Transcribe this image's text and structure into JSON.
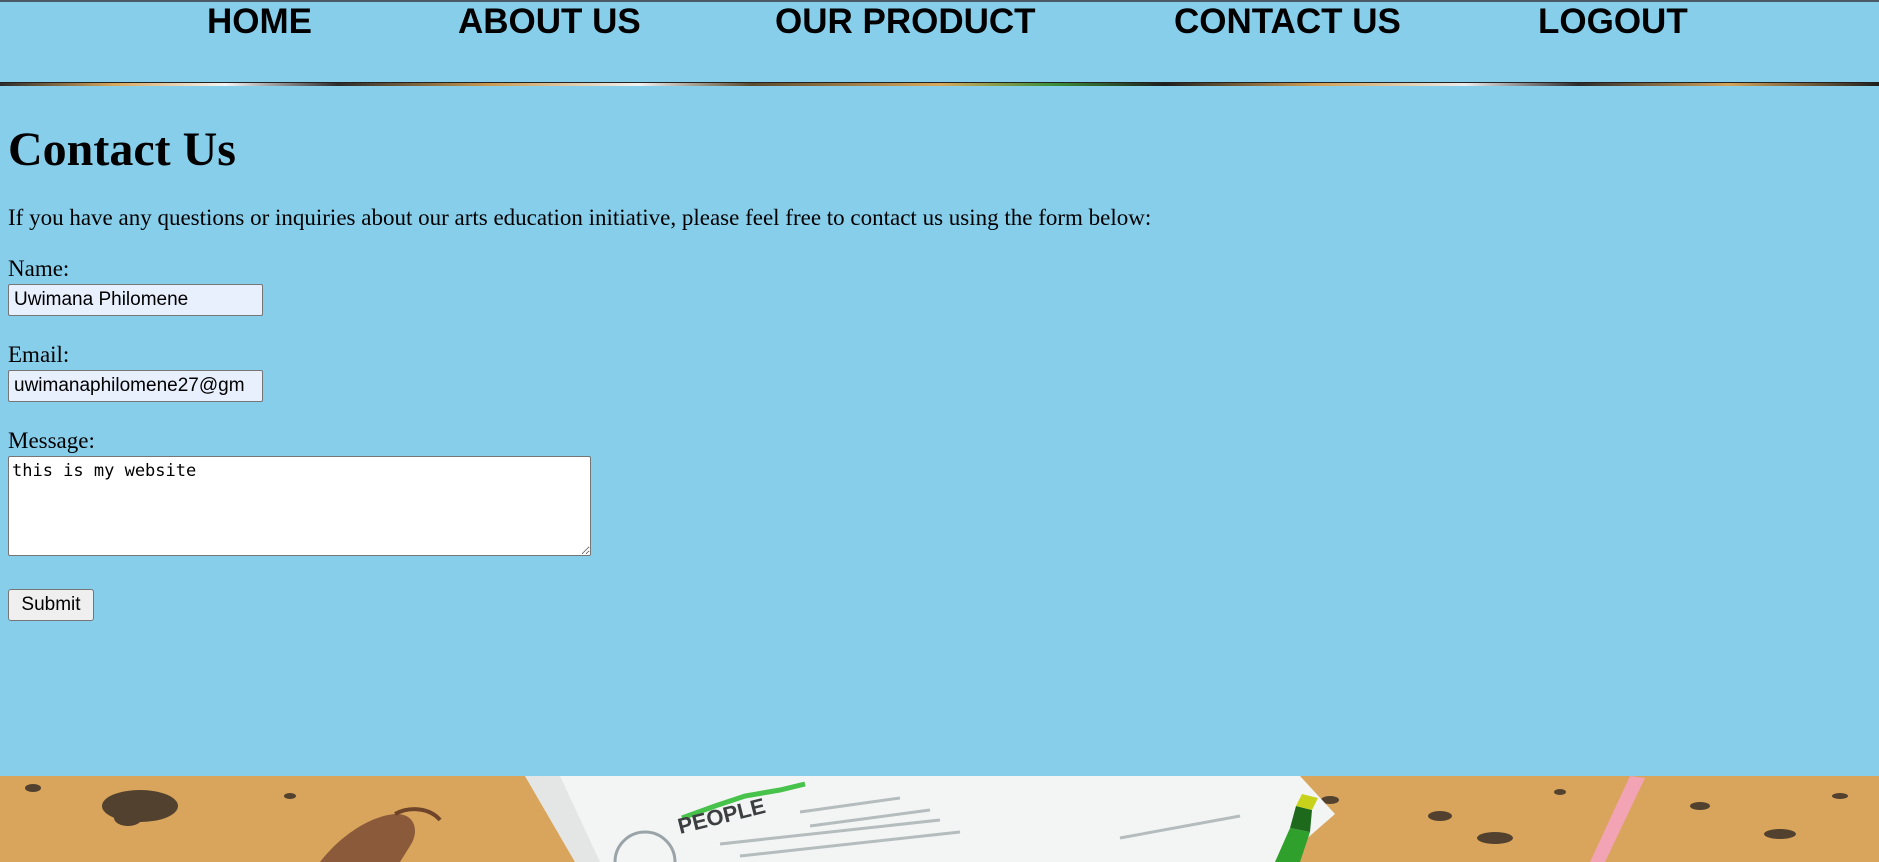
{
  "nav": {
    "home": "HOME",
    "about": "ABOUT US",
    "product": "OUR PRODUCT",
    "contact": "CONTACT US",
    "logout": "LOGOUT"
  },
  "page": {
    "title": "Contact Us",
    "intro": "If you have any questions or inquiries about our arts education initiative, please feel free to contact us using the form below:"
  },
  "form": {
    "name_label": "Name:",
    "name_value": "Uwimana Philomene",
    "email_label": "Email:",
    "email_value": "uwimanaphilomene27@gm",
    "message_label": "Message:",
    "message_value": "this is my website",
    "submit_label": "Submit"
  },
  "footer_image": {
    "paper_word": "PEOPLE"
  },
  "colors": {
    "background": "#87ceeb",
    "autofill": "#e8f0fe",
    "desk": "#d9a55d"
  }
}
